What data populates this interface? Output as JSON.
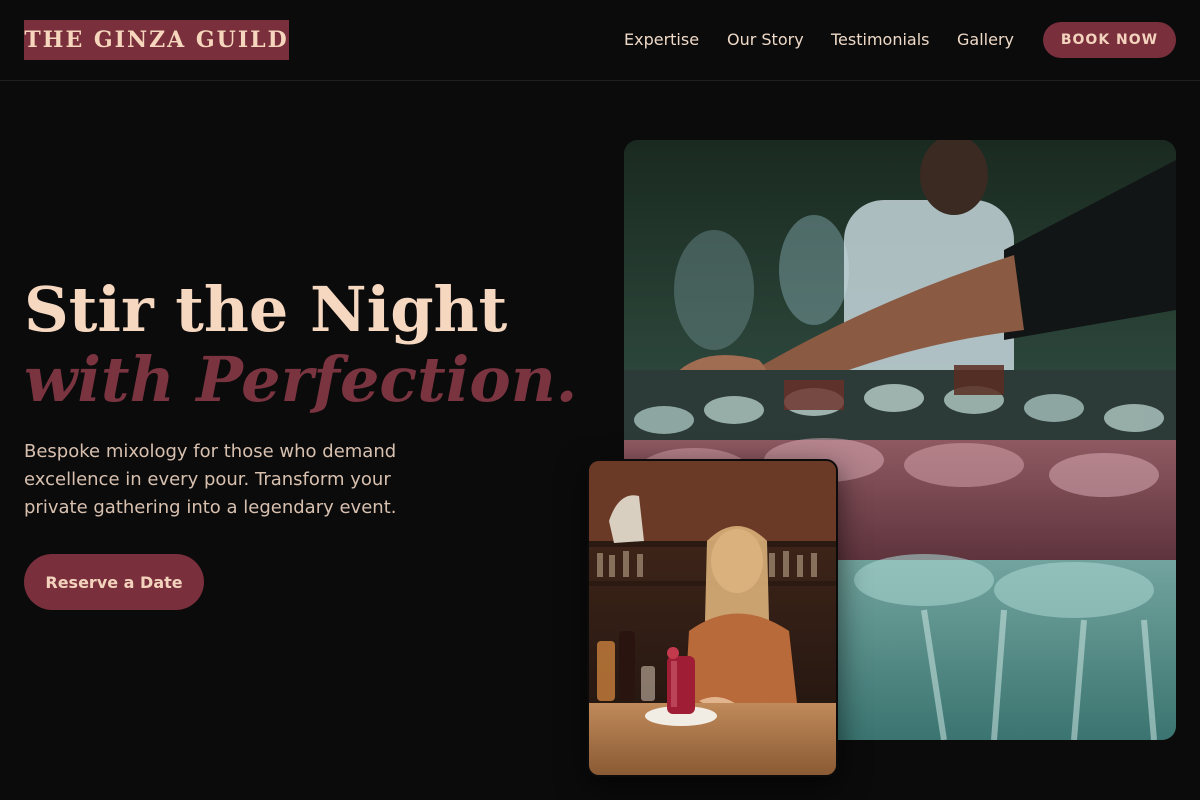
{
  "brand": {
    "name": "THE GINZA GUILD",
    "color": "#7a2f3c"
  },
  "nav": {
    "items": [
      "Expertise",
      "Our Story",
      "Testimonials",
      "Gallery"
    ],
    "cta": "BOOK NOW"
  },
  "hero": {
    "headline_line1": "Stir the Night",
    "headline_line2": "with Perfection.",
    "subtext": "Bespoke mixology for those who demand excellence in every pour. Transform your private gathering into a legendary event.",
    "cta": "Reserve a Date"
  },
  "images": {
    "main": {
      "subject": "bartender arranging rows of wine glasses with red cocktail"
    },
    "secondary": {
      "subject": "smiling bartender serving a red cocktail at a bar counter"
    }
  },
  "colors": {
    "background": "#0b0b0c",
    "accent": "#7a2f3c",
    "headline": "#f6d7c0",
    "headline_accent": "#7a3440"
  }
}
